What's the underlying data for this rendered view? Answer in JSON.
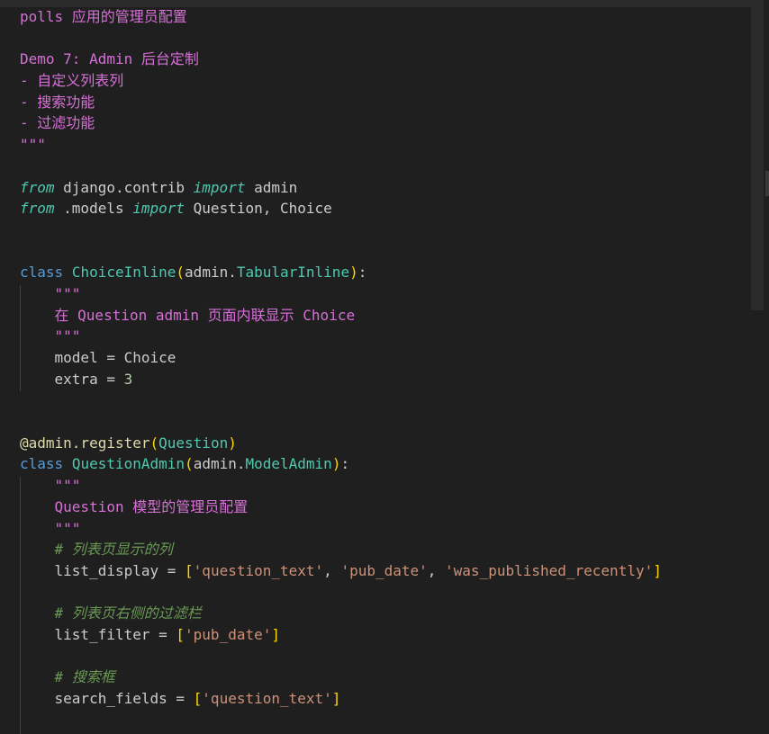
{
  "editor": {
    "lines": [
      [
        {
          "t": "polls 应用的管理员配置",
          "c": "doc"
        }
      ],
      [
        {
          "t": "",
          "c": "txt"
        }
      ],
      [
        {
          "t": "Demo 7: Admin 后台定制",
          "c": "doc"
        }
      ],
      [
        {
          "t": "- 自定义列表列",
          "c": "doc"
        }
      ],
      [
        {
          "t": "- 搜索功能",
          "c": "doc"
        }
      ],
      [
        {
          "t": "- 过滤功能",
          "c": "doc"
        }
      ],
      [
        {
          "t": "\"\"\"",
          "c": "doc"
        }
      ],
      [
        {
          "t": "",
          "c": "txt"
        }
      ],
      [
        {
          "t": "from",
          "c": "kwi"
        },
        {
          "t": " django.contrib ",
          "c": "txt"
        },
        {
          "t": "import",
          "c": "kwi"
        },
        {
          "t": " admin",
          "c": "txt"
        }
      ],
      [
        {
          "t": "from",
          "c": "kwi"
        },
        {
          "t": " .models ",
          "c": "txt"
        },
        {
          "t": "import",
          "c": "kwi"
        },
        {
          "t": " Question, Choice",
          "c": "txt"
        }
      ],
      [
        {
          "t": "",
          "c": "txt"
        }
      ],
      [
        {
          "t": "",
          "c": "txt"
        }
      ],
      [
        {
          "t": "class",
          "c": "kw"
        },
        {
          "t": " ",
          "c": "txt"
        },
        {
          "t": "ChoiceInline",
          "c": "cls"
        },
        {
          "t": "(",
          "c": "br1"
        },
        {
          "t": "admin.",
          "c": "txt"
        },
        {
          "t": "TabularInline",
          "c": "cls"
        },
        {
          "t": ")",
          "c": "br1"
        },
        {
          "t": ":",
          "c": "txt"
        }
      ],
      [
        {
          "t": "    ",
          "c": "txt"
        },
        {
          "t": "\"\"\"",
          "c": "doc"
        }
      ],
      [
        {
          "t": "    ",
          "c": "txt"
        },
        {
          "t": "在 Question admin 页面内联显示 Choice",
          "c": "doc"
        }
      ],
      [
        {
          "t": "    ",
          "c": "txt"
        },
        {
          "t": "\"\"\"",
          "c": "doc"
        }
      ],
      [
        {
          "t": "    model = Choice",
          "c": "txt"
        }
      ],
      [
        {
          "t": "    extra = ",
          "c": "txt"
        },
        {
          "t": "3",
          "c": "num"
        }
      ],
      [
        {
          "t": "",
          "c": "txt"
        }
      ],
      [
        {
          "t": "",
          "c": "txt"
        }
      ],
      [
        {
          "t": "@admin.register",
          "c": "dec"
        },
        {
          "t": "(",
          "c": "br1"
        },
        {
          "t": "Question",
          "c": "cls"
        },
        {
          "t": ")",
          "c": "br1"
        }
      ],
      [
        {
          "t": "class",
          "c": "kw"
        },
        {
          "t": " ",
          "c": "txt"
        },
        {
          "t": "QuestionAdmin",
          "c": "cls"
        },
        {
          "t": "(",
          "c": "br1"
        },
        {
          "t": "admin.",
          "c": "txt"
        },
        {
          "t": "ModelAdmin",
          "c": "cls"
        },
        {
          "t": ")",
          "c": "br1"
        },
        {
          "t": ":",
          "c": "txt"
        }
      ],
      [
        {
          "t": "    ",
          "c": "txt"
        },
        {
          "t": "\"\"\"",
          "c": "doc"
        }
      ],
      [
        {
          "t": "    ",
          "c": "txt"
        },
        {
          "t": "Question 模型的管理员配置",
          "c": "doc"
        }
      ],
      [
        {
          "t": "    ",
          "c": "txt"
        },
        {
          "t": "\"\"\"",
          "c": "doc"
        }
      ],
      [
        {
          "t": "    ",
          "c": "txt"
        },
        {
          "t": "# 列表页显示的列",
          "c": "com"
        }
      ],
      [
        {
          "t": "    list_display = ",
          "c": "txt"
        },
        {
          "t": "[",
          "c": "br1"
        },
        {
          "t": "'question_text'",
          "c": "str"
        },
        {
          "t": ", ",
          "c": "txt"
        },
        {
          "t": "'pub_date'",
          "c": "str"
        },
        {
          "t": ", ",
          "c": "txt"
        },
        {
          "t": "'was_published_recently'",
          "c": "str"
        },
        {
          "t": "]",
          "c": "br1"
        }
      ],
      [
        {
          "t": "",
          "c": "txt"
        }
      ],
      [
        {
          "t": "    ",
          "c": "txt"
        },
        {
          "t": "# 列表页右侧的过滤栏",
          "c": "com"
        }
      ],
      [
        {
          "t": "    list_filter = ",
          "c": "txt"
        },
        {
          "t": "[",
          "c": "br1"
        },
        {
          "t": "'pub_date'",
          "c": "str"
        },
        {
          "t": "]",
          "c": "br1"
        }
      ],
      [
        {
          "t": "",
          "c": "txt"
        }
      ],
      [
        {
          "t": "    ",
          "c": "txt"
        },
        {
          "t": "# 搜索框",
          "c": "com"
        }
      ],
      [
        {
          "t": "    search_fields = ",
          "c": "txt"
        },
        {
          "t": "[",
          "c": "br1"
        },
        {
          "t": "'question_text'",
          "c": "str"
        },
        {
          "t": "]",
          "c": "br1"
        }
      ],
      [
        {
          "t": "",
          "c": "txt"
        }
      ]
    ]
  }
}
